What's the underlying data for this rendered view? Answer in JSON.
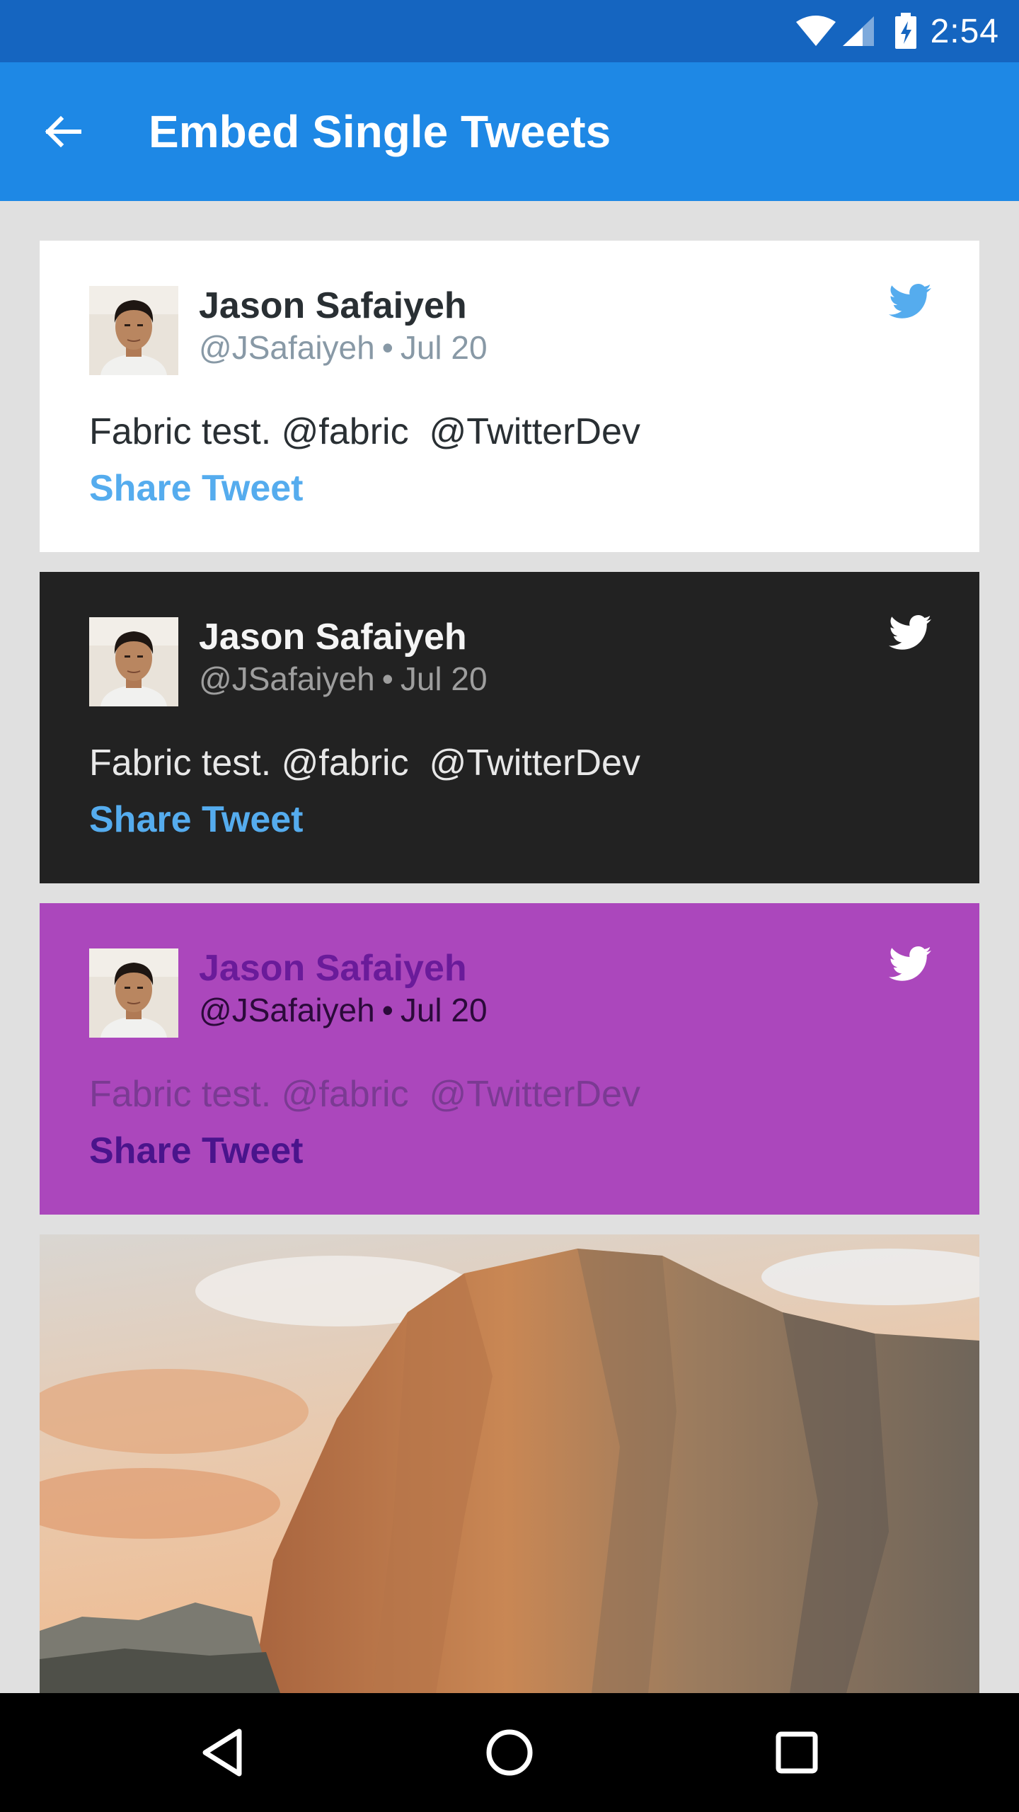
{
  "status_bar": {
    "time": "2:54"
  },
  "app_bar": {
    "title": "Embed Single Tweets"
  },
  "tweets": [
    {
      "theme": "light",
      "name": "Jason Safaiyeh",
      "handle": "@JSafaiyeh",
      "separator": "•",
      "date": "Jul 20",
      "text": "Fabric test. @fabric  @TwitterDev",
      "share_label": "Share Tweet"
    },
    {
      "theme": "dark",
      "name": "Jason Safaiyeh",
      "handle": "@JSafaiyeh",
      "separator": "•",
      "date": "Jul 20",
      "text": "Fabric test. @fabric  @TwitterDev",
      "share_label": "Share Tweet"
    },
    {
      "theme": "purple",
      "name": "Jason Safaiyeh",
      "handle": "@JSafaiyeh",
      "separator": "•",
      "date": "Jul 20",
      "text": "Fabric test. @fabric  @TwitterDev",
      "share_label": "Share Tweet"
    }
  ],
  "colors": {
    "status_bar": "#1565c0",
    "app_bar": "#1e88e5",
    "twitter_blue": "#55acee",
    "dark_card": "#222222",
    "purple_card": "#ab47bc"
  },
  "icons": {
    "back": "arrow-back-icon",
    "tweet_brand": "twitter-bird-icon",
    "nav": [
      "back-triangle-icon",
      "home-circle-icon",
      "recents-square-icon"
    ]
  }
}
